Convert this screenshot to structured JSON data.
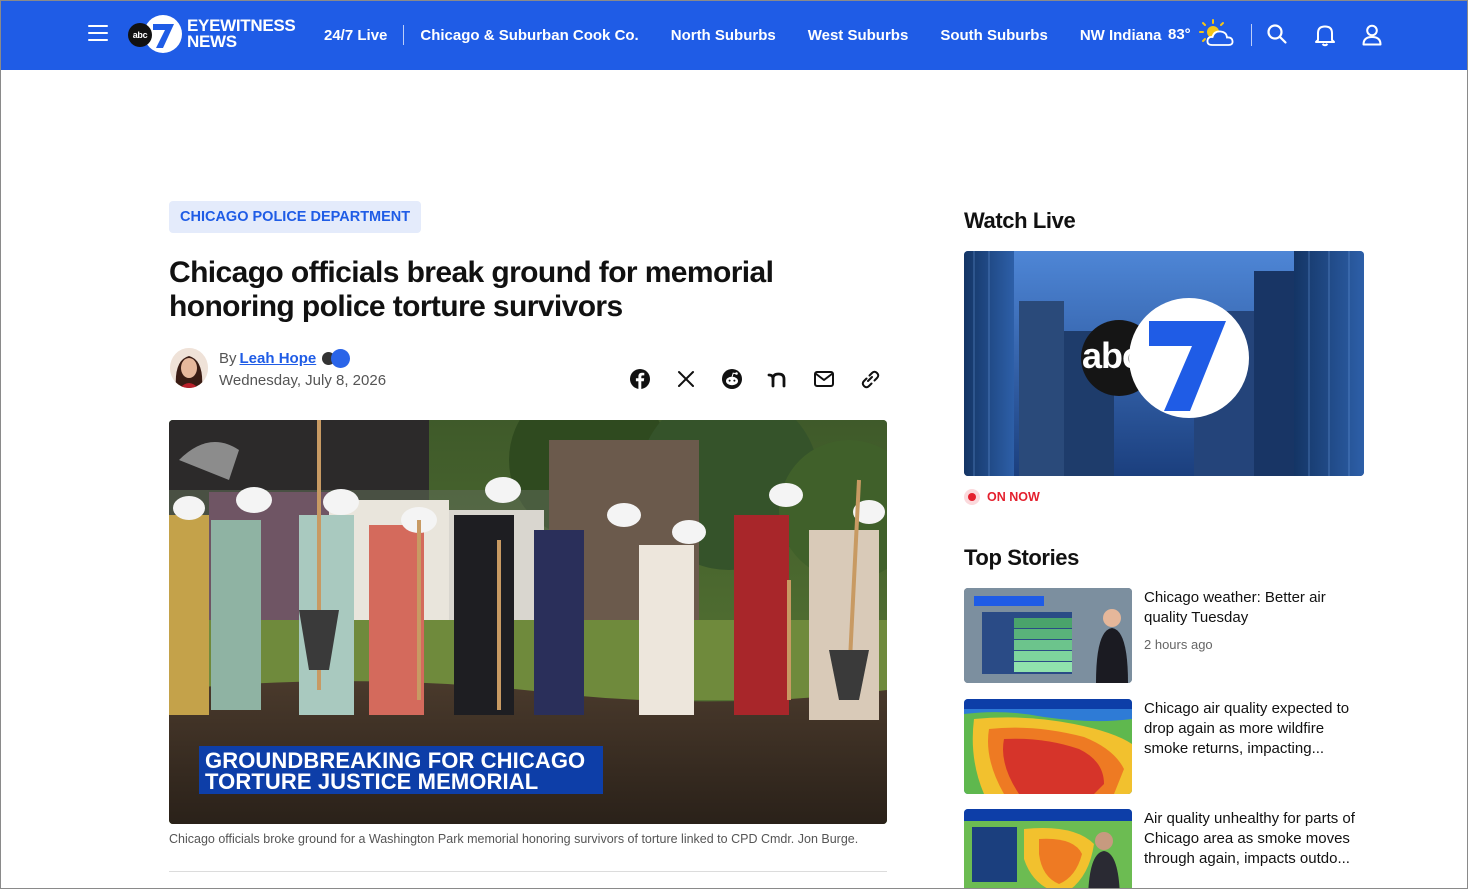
{
  "header": {
    "logo_badge": "abc",
    "logo_line1": "EYEWITNESS",
    "logo_line2": "NEWS",
    "nav": [
      {
        "label": "24/7 Live"
      },
      {
        "label": "Chicago & Suburban Cook Co."
      },
      {
        "label": "North Suburbs"
      },
      {
        "label": "West Suburbs"
      },
      {
        "label": "South Suburbs"
      },
      {
        "label": "NW Indiana"
      }
    ],
    "temperature": "83°",
    "weather_icon": "partly-cloudy-icon",
    "icons": [
      "menu-icon",
      "search-icon",
      "bell-icon",
      "user-icon"
    ]
  },
  "article": {
    "category": "CHICAGO POLICE DEPARTMENT",
    "headline": "Chicago officials break ground for memorial honoring police torture survivors",
    "by_prefix": "By",
    "author": "Leah Hope",
    "date": "Wednesday, July 8, 2026",
    "share_icons": [
      "facebook-icon",
      "x-icon",
      "reddit-icon",
      "nextdoor-icon",
      "email-icon",
      "link-icon"
    ],
    "hero_overlay_line1": "GROUNDBREAKING FOR CHICAGO",
    "hero_overlay_line2": "TORTURE JUSTICE MEMORIAL",
    "caption": "Chicago officials broke ground for a Washington Park memorial honoring survivors of torture linked to CPD Cmdr. Jon Burge."
  },
  "sidebar": {
    "watch_live_title": "Watch Live",
    "player_logo": "abc",
    "on_now": "ON NOW",
    "top_stories_title": "Top Stories",
    "stories": [
      {
        "title": "Chicago weather: Better air quality Tuesday",
        "time": "2 hours ago"
      },
      {
        "title": "Chicago air quality expected to drop again as more wildfire smoke returns, impacting...",
        "time": ""
      },
      {
        "title": "Air quality unhealthy for parts of Chicago area as smoke moves through again, impacts outdo...",
        "time": ""
      }
    ]
  },
  "colors": {
    "brand_blue": "#1f5ce6",
    "live_red": "#e4202e"
  }
}
